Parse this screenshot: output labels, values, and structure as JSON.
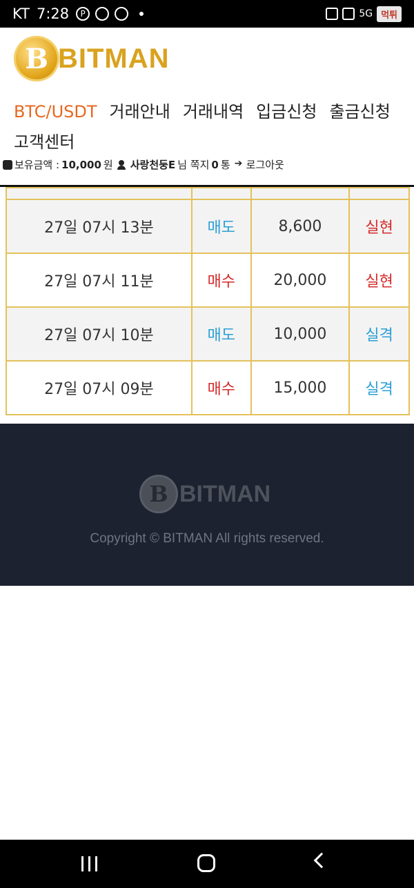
{
  "status_bar": {
    "carrier": "KT",
    "time": "7:28",
    "network": "5G",
    "badge": "먹튀"
  },
  "brand": {
    "logo_letter": "B",
    "name": "BITMAN",
    "accent_color": "#d9a21f"
  },
  "nav": {
    "items": [
      "BTC/USDT",
      "거래안내",
      "거래내역",
      "입금신청",
      "출금신청",
      "고객센터"
    ],
    "active_color": "#e8671f"
  },
  "user": {
    "balance_label": "보유금액 :",
    "balance_value": "10,000",
    "balance_unit": "원",
    "username": "사랑천둥E",
    "honorific": "님",
    "messages_label": "쪽지",
    "messages_count": "0",
    "messages_unit": "통",
    "logout_label": "로그아웃"
  },
  "trades": {
    "rows": [
      {
        "time": "27일 07시 13분",
        "type": "매도",
        "type_kind": "sell",
        "amount": "8,600",
        "result": "실현",
        "result_kind": "win"
      },
      {
        "time": "27일 07시 11분",
        "type": "매수",
        "type_kind": "buy",
        "amount": "20,000",
        "result": "실현",
        "result_kind": "win"
      },
      {
        "time": "27일 07시 10분",
        "type": "매도",
        "type_kind": "sell",
        "amount": "10,000",
        "result": "실격",
        "result_kind": "lose"
      },
      {
        "time": "27일 07시 09분",
        "type": "매수",
        "type_kind": "buy",
        "amount": "15,000",
        "result": "실격",
        "result_kind": "lose"
      }
    ],
    "colors": {
      "sell": "#2a9fd6",
      "buy": "#d62a2a",
      "win": "#d62a2a",
      "lose": "#2a9fd6"
    }
  },
  "footer": {
    "logo_letter": "B",
    "name": "BITMAN",
    "copyright": "Copyright © BITMAN All rights reserved."
  }
}
